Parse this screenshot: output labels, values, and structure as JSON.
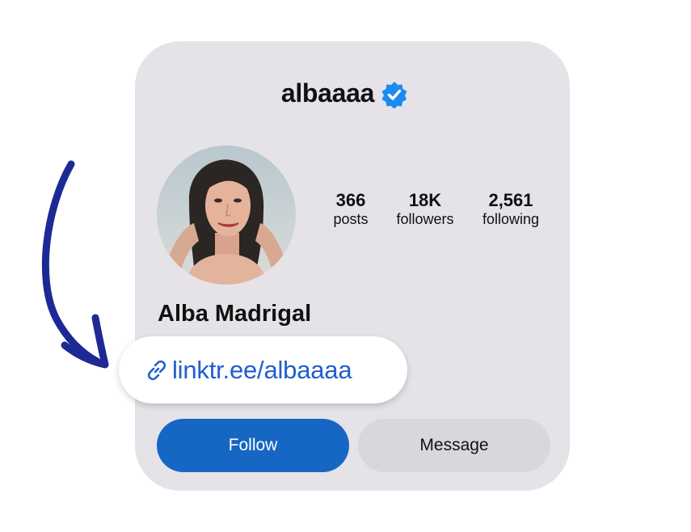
{
  "profile": {
    "username": "albaaaa",
    "full_name": "Alba Madrigal",
    "link": "linktr.ee/albaaaa",
    "avatar_desc": "profile photo"
  },
  "stats": [
    {
      "value": "366",
      "label": "posts"
    },
    {
      "value": "18K",
      "label": "followers"
    },
    {
      "value": "2,561",
      "label": "following"
    }
  ],
  "actions": {
    "follow_label": "Follow",
    "message_label": "Message"
  },
  "icons": {
    "verified": "verified-badge-icon",
    "link": "link-chain-icon",
    "arrow": "hand-drawn-arrow"
  },
  "colors": {
    "card_bg": "#e5e3e7",
    "follow_bg": "#1666c4",
    "link_text": "#1f5ecf",
    "verified_blue": "#1a8cf0",
    "arrow_navy": "#1d2a95"
  }
}
